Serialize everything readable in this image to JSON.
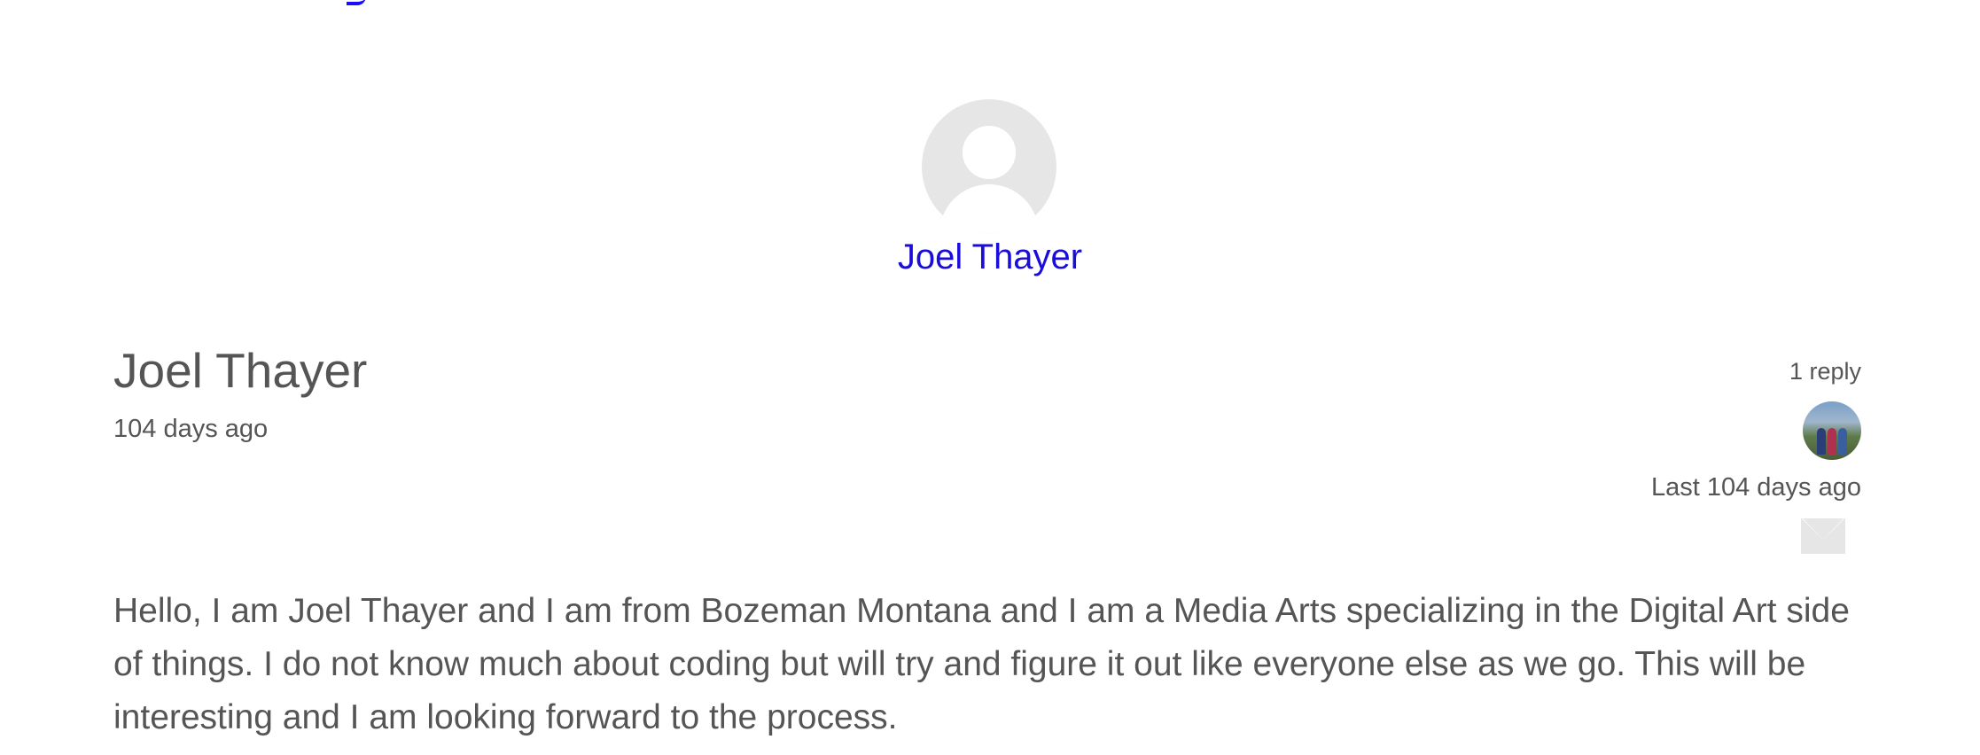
{
  "author": {
    "name": "Joel Thayer",
    "avatar_icon": "default-user-silhouette"
  },
  "post": {
    "title": "Joel Thayer",
    "time_ago": "104 days ago",
    "body": "Hello, I am Joel Thayer and I am from Bozeman Montana and I am a Media Arts specializing in the Digital Art side of things. I do not know much about coding but will try and figure it out like everyone else as we go. This will be interesting and I am looking forward to the process."
  },
  "replies": {
    "count_label": "1 reply",
    "last_label": "Last 104 days ago",
    "avatar_icon": "group-photo-avatar",
    "mail_icon": "mail-icon"
  },
  "colors": {
    "link": "#1a0dd9",
    "text": "#555555",
    "placeholder": "#e6e6e6"
  }
}
